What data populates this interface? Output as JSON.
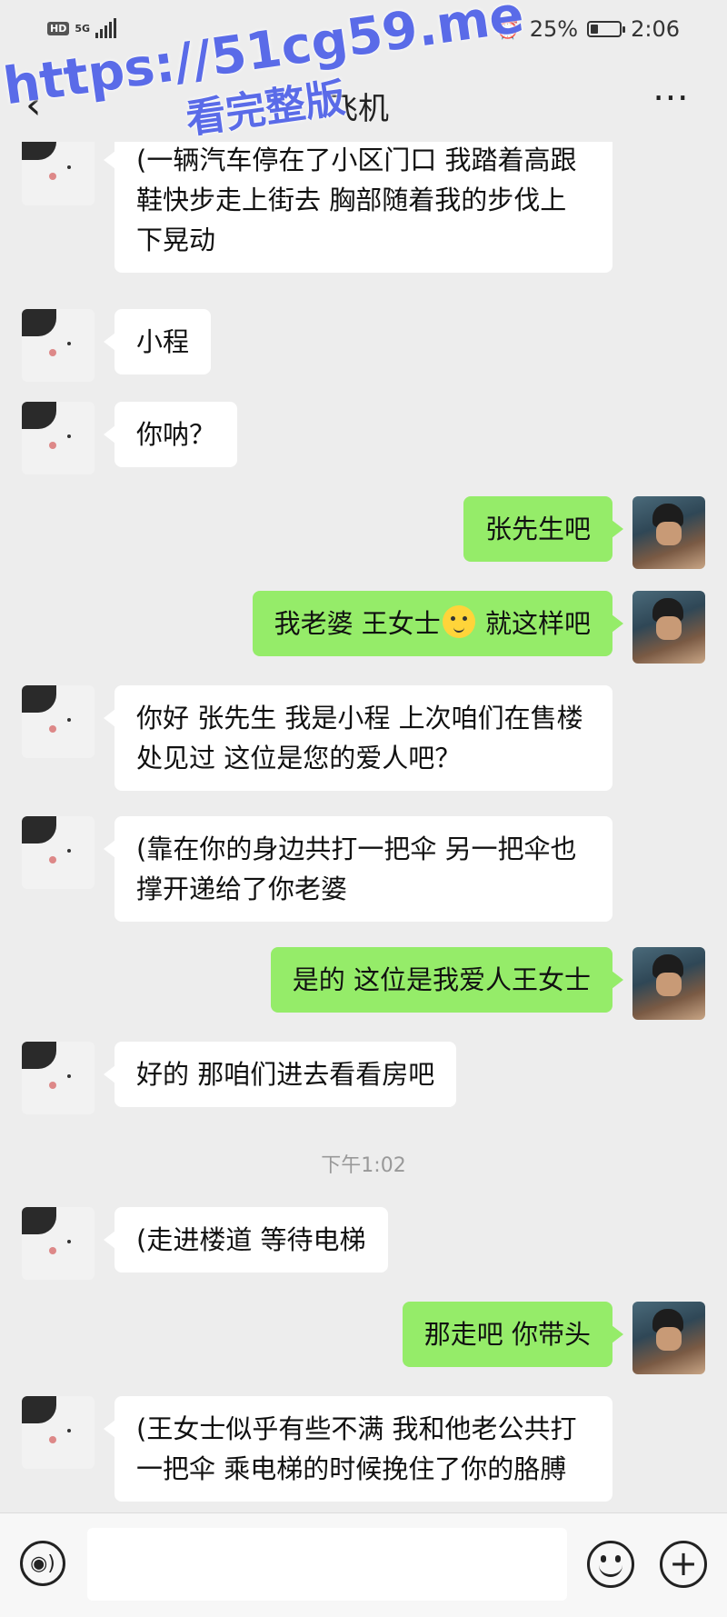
{
  "status_bar": {
    "hd": "HD",
    "network": "5G",
    "battery_text": "25%",
    "battery_level": 0.25,
    "time": "2:06"
  },
  "header": {
    "back_icon": "chevron-left-icon",
    "title": "飞机",
    "more_icon": "more-dots-icon"
  },
  "watermark": {
    "line1": "https://51cg59.me",
    "line2": "看完整版"
  },
  "messages": [
    {
      "side": "left",
      "text": "(一辆汽车停在了小区门口 我踏着高跟鞋快步走上街去 胸部随着我的步伐上下晃动"
    },
    {
      "side": "left",
      "text": "小程"
    },
    {
      "side": "left",
      "text": "你呐？"
    },
    {
      "side": "right",
      "text": "张先生吧"
    },
    {
      "side": "right",
      "text_before": "我老婆 王女士",
      "emoji": "sweat-smile-emoji",
      "text_after": " 就这样吧"
    },
    {
      "side": "left",
      "text": "你好 张先生  我是小程 上次咱们在售楼处见过 这位是您的爱人吧？"
    },
    {
      "side": "left",
      "text": "(靠在你的身边共打一把伞 另一把伞也撑开递给了你老婆"
    },
    {
      "side": "right",
      "text": "是的 这位是我爱人王女士"
    },
    {
      "side": "left",
      "text": "好的 那咱们进去看看房吧"
    },
    {
      "type": "time",
      "text": "下午1:02"
    },
    {
      "side": "left",
      "text": "(走进楼道 等待电梯"
    },
    {
      "side": "right",
      "text": "那走吧 你带头"
    },
    {
      "side": "left",
      "text": "(王女士似乎有些不满 我和他老公共打一把伞 乘电梯的时候挽住了你的胳膊"
    }
  ],
  "input_bar": {
    "voice_icon": "voice-icon",
    "emoji_icon": "emoji-icon",
    "plus_icon": "plus-icon"
  }
}
